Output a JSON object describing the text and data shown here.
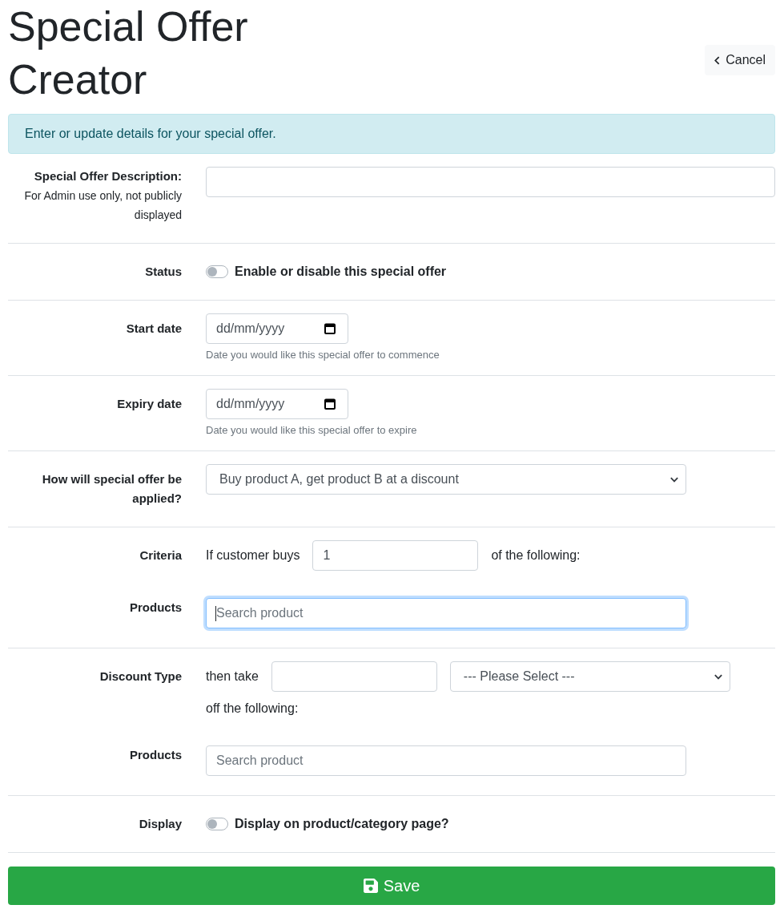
{
  "header": {
    "title": "Special Offer Creator",
    "cancel_button": "Cancel"
  },
  "alert": "Enter or update details for your special offer.",
  "sections": [
    {
      "rows": [
        {
          "kind": "text",
          "label": "Special Offer Description:",
          "note": "For Admin use only, not publicly displayed"
        }
      ]
    },
    {
      "rows": [
        {
          "kind": "toggle",
          "label": "Status",
          "text": "Enable or disable this special offer",
          "on": false
        }
      ]
    },
    {
      "rows": [
        {
          "kind": "date",
          "label": "Start date",
          "placeholder": "dd/mm/yyyy",
          "help": "Date you would like this special offer to commence"
        }
      ]
    },
    {
      "rows": [
        {
          "kind": "date",
          "label": "Expiry date",
          "placeholder": "dd/mm/yyyy",
          "help": "Date you would like this special offer to expire"
        }
      ]
    },
    {
      "rows": [
        {
          "kind": "select",
          "label": "How will special offer be applied?",
          "value": "Buy product A, get product B at a discount"
        }
      ]
    },
    {
      "rows": [
        {
          "kind": "quantity",
          "label": "Criteria",
          "prefix": "If customer buys",
          "value": "1",
          "suffix": "of the following:"
        },
        {
          "kind": "search",
          "label": "Products",
          "placeholder": "Search product",
          "focused": true
        }
      ]
    },
    {
      "rows": [
        {
          "kind": "discount",
          "label": "Discount Type",
          "prefix": "then take",
          "select": "--- Please Select ---",
          "suffix": "off the following:"
        },
        {
          "kind": "search",
          "label": "Products",
          "placeholder": "Search product",
          "focused": false
        }
      ]
    },
    {
      "rows": [
        {
          "kind": "toggle",
          "label": "Display",
          "text": "Display on product/category page?",
          "on": false
        }
      ]
    }
  ],
  "save_button": "Save"
}
